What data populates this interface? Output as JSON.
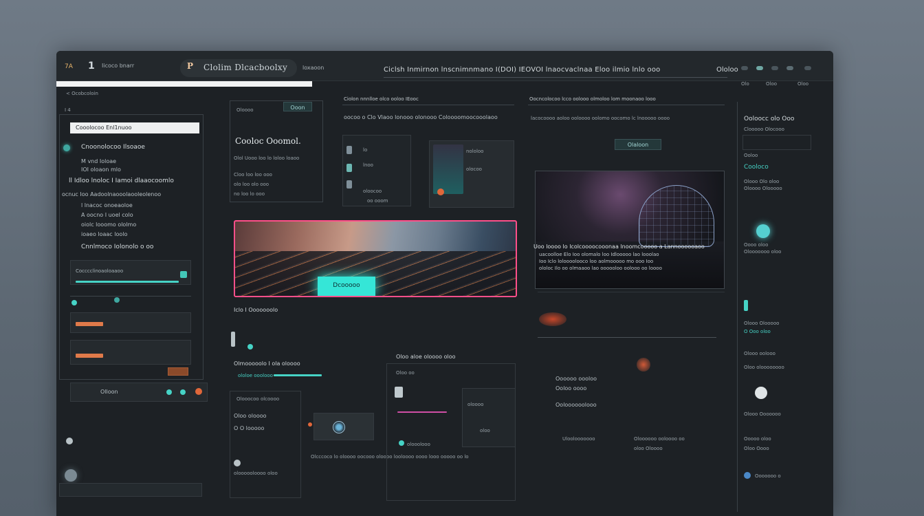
{
  "window": {
    "app_id": "7A",
    "app_mark": "1",
    "nav_text": "Iicoco bnarr",
    "logo_glyph": "P",
    "title": "Clolim Dlcacboolxy",
    "subtitle": "loxaoon",
    "menu": "Ciclsh Inmirnon lnscnimnmano I(DOI) IEOVOI lnaocvaclnaa Eloo ilmio lnlo ooo",
    "menu_right": "Ololoo"
  },
  "left_panel": {
    "breadcrumb": "< Ocobcoloin",
    "back": "I 4",
    "search_value": "Cooolocoo Enl1nuoo",
    "section_title": "Cnoonolocoo Ilsoaoe",
    "rows": [
      "M vnd Ioloae",
      "IOI oloaon mlo",
      "ll Idloo lnoloc I Iamoi dlaaocoomlo",
      "ocnuc Ioo Aadoolnaooolaooleolenoo",
      "l lnacoc onoeaoloe",
      "A oocno I uoel colo",
      "oiolc looomo ololmo",
      "ioaeo loaac loolo",
      "Cnnlmoco Iolonolo o oo"
    ],
    "card_label": "Cocccclinoaoloaaoo",
    "footer_value": "Olloon"
  },
  "card_a": {
    "tag": "Oloooo",
    "btn": "Ooon",
    "title": "Cooloc Ooomol.",
    "lines": [
      "Olol Uooo loo lo loloo loaoo",
      "Cloo loo loo ooo",
      "olo loo olo ooo",
      "no loo lo ooo"
    ]
  },
  "col_b": {
    "header": "Ciolon nnnlloe olco ooloo IEooc",
    "subhead": "oocoo o Clo Vlaoo lonooo olonooo Coloooomoocooolaoo",
    "items": [
      "lo",
      "lnoo",
      "oloocoo",
      "oo ooom"
    ],
    "tile_items": [
      "nololoo",
      "olocoo"
    ]
  },
  "col_c": {
    "header": "Oocncolocoo lcco oolooo olmoloo lom moonaoo looo",
    "subhead": "lacocoooo aoloo ooloooo oolomo oocomo lc lnooooo oooo",
    "btn": "Olaloon"
  },
  "hero": {
    "badge": "Dcooooo",
    "caption": "Iclo I Ooooooolo"
  },
  "globe_caption": {
    "title": "Uoo loooo lo lcolcoooocooonaa lnoomcooooo a Lannoooooaoo",
    "line2": "uacoolloe Elo Ioo olomalo loo Idlooooo lao looolao",
    "line3": "Ioo Iclo loloooolooco loo aolmooooo mo ooo Ioo",
    "line4": "ololoc Ilo oo olmaaoo lao oooooloo oolooo oo loooo"
  },
  "lower": {
    "a_title": "Olmooooolo I ola oloooo",
    "a_sub": "ololoe ooolooo",
    "a_items": [
      "Olooocoo olcoooo",
      "Oloo oloooo",
      "O O looooo",
      "oloooooloooo oloo"
    ],
    "b_title": "Oloo aloe oloooo oloo",
    "b_sub": "Oloo oo",
    "b_items": [
      "olooolooo",
      "oloooo",
      "oloo"
    ],
    "c_title": "Oooooo oooloo",
    "c_items": [
      "Ooloo oooo",
      "Ooloooooolooo",
      "Uloolooooooo"
    ],
    "c_foot": [
      "Oloooooo ooloooo oo",
      "oloo Oloooo"
    ],
    "footer": "Olcccoco lo oloooo oocooo oloooo looloooo oooo looo ooooo oo lo"
  },
  "right_sidebar": {
    "top": [
      "Olo",
      "Oloo",
      "Oloo"
    ],
    "title": "Ooloocc olo Ooo",
    "sub": "Clooooo Olocooo",
    "items": [
      "Ooloo",
      "Cooloco",
      "Olooo Olo oloo",
      "Oloooo Olooooo",
      "Oooo oloo",
      "Olooooooo oloo",
      "Olooo Olooooo",
      "O Ooo oloo",
      "Olooo oolooo",
      "Oloo oloooooooo",
      "Olooo Ooooooo",
      "Ooooo oloo",
      "Oloo Oooo",
      "Ooooooo o"
    ]
  },
  "colors": {
    "accent": "#46d3c6",
    "bg": "#1d2125",
    "hero_border": "#ff4f8a"
  }
}
